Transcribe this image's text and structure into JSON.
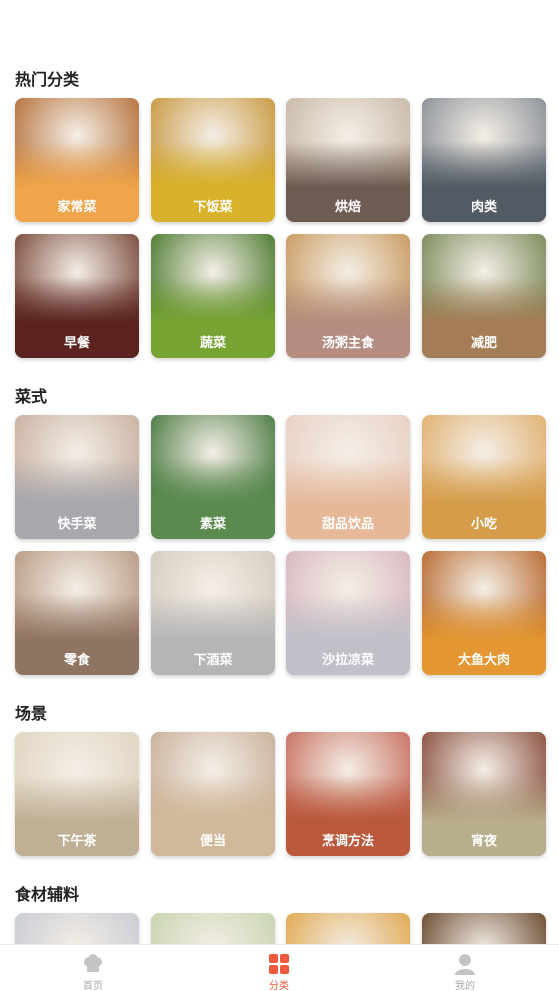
{
  "sections": [
    {
      "title": "热门分类",
      "items": [
        {
          "label": "家常菜",
          "color": "#f0a54a",
          "photo": "#b5703a"
        },
        {
          "label": "下饭菜",
          "color": "#d8b22a",
          "photo": "#c89840"
        },
        {
          "label": "烘焙",
          "color": "#6e5c52",
          "photo": "#c8b8a6"
        },
        {
          "label": "肉类",
          "color": "#525a63",
          "photo": "#8a9098"
        },
        {
          "label": "早餐",
          "color": "#5a2320",
          "photo": "#7a4a3c"
        },
        {
          "label": "蔬菜",
          "color": "#77a332",
          "photo": "#4c7a30"
        },
        {
          "label": "汤粥主食",
          "color": "#b48c80",
          "photo": "#c89a60"
        },
        {
          "label": "减肥",
          "color": "#a47c55",
          "photo": "#7a8a5a"
        }
      ]
    },
    {
      "title": "菜式",
      "items": [
        {
          "label": "快手菜",
          "color": "#a7a7ad",
          "photo": "#c8b0a0"
        },
        {
          "label": "素菜",
          "color": "#5b8a4f",
          "photo": "#4a7a42"
        },
        {
          "label": "甜品饮品",
          "color": "#e6b898",
          "photo": "#e8d0c4"
        },
        {
          "label": "小吃",
          "color": "#d59c4a",
          "photo": "#e0b070"
        },
        {
          "label": "零食",
          "color": "#907462",
          "photo": "#b89a84"
        },
        {
          "label": "下酒菜",
          "color": "#b5b5b8",
          "photo": "#d4ccc0"
        },
        {
          "label": "沙拉凉菜",
          "color": "#c0c0c9",
          "photo": "#d8b8c0"
        },
        {
          "label": "大鱼大肉",
          "color": "#e39631",
          "photo": "#b86a30"
        }
      ]
    },
    {
      "title": "场景",
      "items": [
        {
          "label": "下午茶",
          "color": "#bfaf95",
          "photo": "#e0d4c0"
        },
        {
          "label": "便当",
          "color": "#d2b89a",
          "photo": "#c8b09a"
        },
        {
          "label": "烹调方法",
          "color": "#b9583a",
          "photo": "#c87060"
        },
        {
          "label": "宵夜",
          "color": "#b8ae8c",
          "photo": "#8a5040"
        }
      ]
    },
    {
      "title": "食材辅料",
      "items": [
        {
          "label": "",
          "color": "#d0d4dc",
          "photo": "#c8ccd4"
        },
        {
          "label": "",
          "color": "#d0d6c0",
          "photo": "#c8d4b0"
        },
        {
          "label": "",
          "color": "#e8c070",
          "photo": "#e0a850"
        },
        {
          "label": "",
          "color": "#7a5a3a",
          "photo": "#6a4a30"
        }
      ]
    }
  ],
  "tabbar": {
    "home": "首页",
    "category": "分类",
    "mine": "我的",
    "active_color": "#ef5a3c",
    "inactive_color": "#a8a8a8"
  }
}
